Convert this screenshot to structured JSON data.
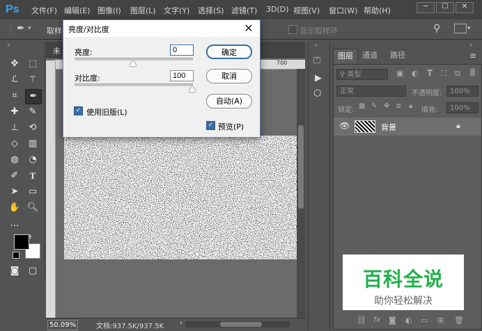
{
  "app": {
    "logo": "Ps"
  },
  "menu": [
    "文件(F)",
    "编辑(E)",
    "图像(I)",
    "图层(L)",
    "文字(Y)",
    "选择(S)",
    "滤镜(T)",
    "3D(D)",
    "视图(V)",
    "窗口(W)",
    "帮助(H)"
  ],
  "window_controls": {
    "minimize": "─",
    "restore": "☐",
    "close": "✕"
  },
  "options_bar": {
    "sample_label": "取样",
    "show_ring": "显示取样环"
  },
  "document": {
    "tab_label": "未",
    "ruler_mark": "700",
    "zoom": "50.09%",
    "doc_info": "文档:937.5K/937.5K"
  },
  "dialog": {
    "title": "亮度/对比度",
    "brightness_label": "亮度:",
    "brightness_value": "0",
    "contrast_label": "对比度:",
    "contrast_value": "100",
    "legacy_label": "使用旧版(L)",
    "ok_label": "确定",
    "cancel_label": "取消",
    "auto_label": "自动(A)",
    "preview_label": "预览(P)",
    "legacy_checked": true,
    "preview_checked": true
  },
  "layers_panel": {
    "tabs": [
      "图层",
      "通道",
      "路径"
    ],
    "kind_filter": "类型",
    "blend_mode": "正常",
    "opacity_label": "不透明度:",
    "opacity_value": "100%",
    "lock_label": "锁定:",
    "fill_label": "填充:",
    "fill_value": "100%",
    "layers": [
      {
        "name": "背景",
        "visible": true,
        "locked": true
      }
    ]
  },
  "watermark": {
    "title": "百科全说",
    "subtitle": "助你轻松解决"
  },
  "colors": {
    "accent": "#31a8ff",
    "dialog_bg": "#f0f0f0",
    "watermark_green": "#22b14c"
  }
}
